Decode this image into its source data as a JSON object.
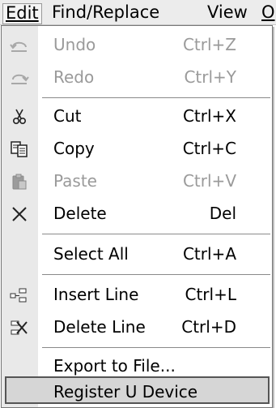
{
  "menubar": {
    "items": [
      {
        "label": "Edit",
        "active": true
      },
      {
        "label": "Find/Replace"
      },
      {
        "label": "View"
      },
      {
        "label": "O"
      }
    ]
  },
  "menu": {
    "undo": {
      "label": "Undo",
      "shortcut": "Ctrl+Z",
      "enabled": false
    },
    "redo": {
      "label": "Redo",
      "shortcut": "Ctrl+Y",
      "enabled": false
    },
    "cut": {
      "label": "Cut",
      "shortcut": "Ctrl+X",
      "enabled": true
    },
    "copy": {
      "label": "Copy",
      "shortcut": "Ctrl+C",
      "enabled": true
    },
    "paste": {
      "label": "Paste",
      "shortcut": "Ctrl+V",
      "enabled": false
    },
    "delete": {
      "label": "Delete",
      "shortcut": "Del",
      "enabled": true
    },
    "select_all": {
      "label": "Select All",
      "shortcut": "Ctrl+A",
      "enabled": true
    },
    "insert_line": {
      "label": "Insert Line",
      "shortcut": "Ctrl+L",
      "enabled": true
    },
    "delete_line": {
      "label": "Delete Line",
      "shortcut": "Ctrl+D",
      "enabled": true
    },
    "export": {
      "label": "Export to File...",
      "enabled": true
    },
    "register": {
      "label": "Register U Device",
      "enabled": true,
      "highlighted": true
    }
  },
  "icons": {
    "undo": "undo-arrow-icon",
    "redo": "redo-arrow-icon",
    "cut": "scissors-icon",
    "copy": "copy-icon",
    "paste": "paste-icon",
    "delete": "delete-x-icon",
    "insert_line": "insert-line-icon",
    "delete_line": "delete-line-icon"
  },
  "colors": {
    "disabled_text": "#9a9a9a",
    "icon_column": "#e9e9e9",
    "highlight": "#d6d6d6"
  }
}
